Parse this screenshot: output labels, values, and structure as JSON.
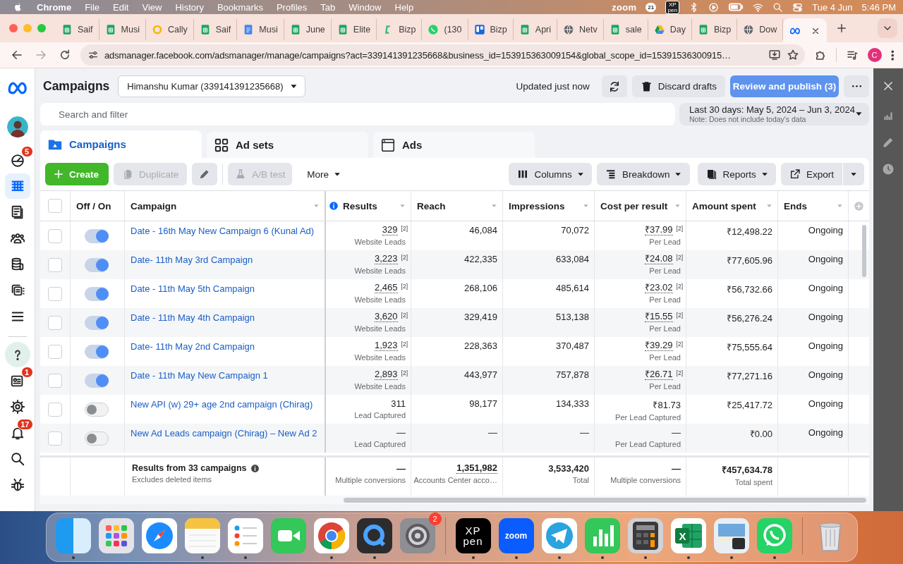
{
  "menu_bar": {
    "app": "Chrome",
    "menus": [
      "File",
      "Edit",
      "View",
      "History",
      "Bookmarks",
      "Profiles",
      "Tab",
      "Window",
      "Help"
    ],
    "status": [
      {
        "kind": "zoom",
        "label": "zoom"
      },
      {
        "kind": "count",
        "label": "21"
      },
      {
        "kind": "xppen",
        "label": "XP pen"
      },
      {
        "kind": "bluetooth"
      },
      {
        "kind": "play"
      },
      {
        "kind": "battery"
      },
      {
        "kind": "wifi"
      },
      {
        "kind": "search"
      },
      {
        "kind": "control"
      }
    ],
    "date": "Tue 4 Jun",
    "time": "5:46 PM"
  },
  "browser": {
    "tabs": [
      {
        "kind": "sheets",
        "label": "Saif",
        "selected": false
      },
      {
        "kind": "sheets",
        "label": "Musi",
        "selected": false
      },
      {
        "kind": "cally",
        "label": "Cally",
        "selected": false
      },
      {
        "kind": "sheets",
        "label": "Saif",
        "selected": false
      },
      {
        "kind": "docs",
        "label": "Musi",
        "selected": false
      },
      {
        "kind": "sheets",
        "label": "June",
        "selected": false
      },
      {
        "kind": "sheets",
        "label": "Elite",
        "selected": false
      },
      {
        "kind": "bizp",
        "label": "Bizp",
        "selected": false
      },
      {
        "kind": "whatsapp",
        "label": "(130",
        "selected": false
      },
      {
        "kind": "trello",
        "label": "Bizp",
        "selected": false
      },
      {
        "kind": "sheets",
        "label": "Apri",
        "selected": false
      },
      {
        "kind": "globe",
        "label": "Netv",
        "selected": false
      },
      {
        "kind": "sheets",
        "label": "sale",
        "selected": false
      },
      {
        "kind": "drive",
        "label": "Day",
        "selected": false
      },
      {
        "kind": "sheets",
        "label": "Bizp",
        "selected": false
      },
      {
        "kind": "globe",
        "label": "Dow",
        "selected": false
      },
      {
        "kind": "meta",
        "selected": true
      }
    ],
    "url": "adsmanager.facebook.com/adsmanager/manage/campaigns?act=339141391235668&business_id=153915363009154&global_scope_id=15391536300915…",
    "profile": "C"
  },
  "sidebar": {
    "top": [
      {
        "kind": "dashboard",
        "badge": "5",
        "selected": false
      },
      {
        "kind": "campaigns",
        "selected": true
      },
      {
        "kind": "pages",
        "selected": false
      },
      {
        "kind": "audiences",
        "selected": false
      },
      {
        "kind": "billing",
        "selected": false
      },
      {
        "kind": "ads",
        "selected": false
      },
      {
        "kind": "menu",
        "selected": false
      }
    ],
    "bottom": [
      {
        "kind": "help",
        "selected": false
      },
      {
        "kind": "news",
        "badge": "1",
        "selected": false
      },
      {
        "kind": "settings",
        "selected": false
      },
      {
        "kind": "notifications",
        "badge": "17",
        "selected": false
      },
      {
        "kind": "search",
        "selected": false
      },
      {
        "kind": "bug",
        "selected": false
      }
    ]
  },
  "header": {
    "title": "Campaigns",
    "account": "Himanshu Kumar (339141391235668)",
    "updated": "Updated just now",
    "buttons": [
      {
        "kind": "refresh"
      },
      {
        "kind": "discard",
        "label": "Discard drafts"
      },
      {
        "kind": "publish",
        "label": "Review and publish (3)",
        "disabled": true
      },
      {
        "kind": "more"
      }
    ]
  },
  "search": {
    "placeholder": "Search and filter"
  },
  "date_range": {
    "label": "Last 30 days: May 5, 2024 – Jun 3, 2024",
    "note": "Note: Does not include today's data"
  },
  "tabs": [
    {
      "kind": "campaigns",
      "label": "Campaigns",
      "selected": true
    },
    {
      "kind": "adsets",
      "label": "Ad sets",
      "selected": false
    },
    {
      "kind": "ads",
      "label": "Ads",
      "selected": false
    }
  ],
  "toolbar": {
    "left": [
      {
        "kind": "create",
        "label": "Create",
        "disabled": false
      },
      {
        "kind": "duplicate",
        "label": "Duplicate",
        "disabled": true
      },
      {
        "kind": "edit",
        "disabled": true
      },
      {
        "kind": "abtest",
        "label": "A/B test",
        "disabled": true
      },
      {
        "kind": "more",
        "label": "More",
        "disabled": false
      }
    ],
    "right": [
      {
        "kind": "columns",
        "label": "Columns"
      },
      {
        "kind": "breakdown",
        "label": "Breakdown"
      },
      {
        "kind": "reports",
        "label": "Reports"
      },
      {
        "kind": "export",
        "label": "Export"
      },
      {
        "kind": "export-menu"
      }
    ]
  },
  "table": {
    "all_checked": false,
    "columns": [
      {
        "label": "Off / On"
      },
      {
        "label": "Campaign",
        "menu": true
      },
      {
        "label": "Results",
        "menu": true,
        "info": true
      },
      {
        "label": "Reach",
        "menu": true
      },
      {
        "label": "Impressions",
        "menu": true
      },
      {
        "label": "Cost per result",
        "menu": true
      },
      {
        "label": "Amount spent",
        "menu": true
      },
      {
        "label": "Ends",
        "menu": true
      }
    ],
    "rows": [
      {
        "checked": false,
        "off_on": true,
        "campaign": "Date - 16th May New Campaign 6 (Kunal Ad)",
        "results": {
          "value": "329",
          "note": "[2]",
          "sub": "Website Leads",
          "dotted": true
        },
        "reach": "46,084",
        "impressions": "70,072",
        "cost_per_result": {
          "value": "₹37.99",
          "note": "[2]",
          "sub": "Per Lead",
          "dotted": true
        },
        "amount_spent": "₹12,498.22",
        "ends": "Ongoing"
      },
      {
        "checked": false,
        "off_on": true,
        "campaign": "Date- 11th May 3rd Campaign",
        "results": {
          "value": "3,223",
          "note": "[2]",
          "sub": "Website Leads",
          "dotted": true
        },
        "reach": "422,335",
        "impressions": "633,084",
        "cost_per_result": {
          "value": "₹24.08",
          "note": "[2]",
          "sub": "Per Lead",
          "dotted": true
        },
        "amount_spent": "₹77,605.96",
        "ends": "Ongoing"
      },
      {
        "checked": false,
        "off_on": true,
        "campaign": "Date - 11th May 5th Campaign",
        "results": {
          "value": "2,465",
          "note": "[2]",
          "sub": "Website Leads",
          "dotted": true
        },
        "reach": "268,106",
        "impressions": "485,614",
        "cost_per_result": {
          "value": "₹23.02",
          "note": "[2]",
          "sub": "Per Lead",
          "dotted": true
        },
        "amount_spent": "₹56,732.66",
        "ends": "Ongoing"
      },
      {
        "checked": false,
        "off_on": true,
        "campaign": "Date - 11th May 4th Campaign",
        "results": {
          "value": "3,620",
          "note": "[2]",
          "sub": "Website Leads",
          "dotted": true
        },
        "reach": "329,419",
        "impressions": "513,138",
        "cost_per_result": {
          "value": "₹15.55",
          "note": "[2]",
          "sub": "Per Lead",
          "dotted": true
        },
        "amount_spent": "₹56,276.24",
        "ends": "Ongoing"
      },
      {
        "checked": false,
        "off_on": true,
        "campaign": "Date- 11th May 2nd Campaign",
        "results": {
          "value": "1,923",
          "note": "[2]",
          "sub": "Website Leads",
          "dotted": true
        },
        "reach": "228,363",
        "impressions": "370,487",
        "cost_per_result": {
          "value": "₹39.29",
          "note": "[2]",
          "sub": "Per Lead",
          "dotted": true
        },
        "amount_spent": "₹75,555.64",
        "ends": "Ongoing"
      },
      {
        "checked": false,
        "off_on": true,
        "campaign": "Date - 11th May New Campaign 1",
        "results": {
          "value": "2,893",
          "note": "[2]",
          "sub": "Website Leads",
          "dotted": true
        },
        "reach": "443,977",
        "impressions": "757,878",
        "cost_per_result": {
          "value": "₹26.71",
          "note": "[2]",
          "sub": "Per Lead",
          "dotted": true
        },
        "amount_spent": "₹77,271.16",
        "ends": "Ongoing"
      },
      {
        "checked": false,
        "off_on": false,
        "campaign": "New API (w) 29+ age 2nd campaign (Chirag)",
        "results": {
          "value": "311",
          "sub": "Lead Captured"
        },
        "reach": "98,177",
        "impressions": "134,333",
        "cost_per_result": {
          "value": "₹81.73",
          "sub": "Per Lead Captured"
        },
        "amount_spent": "₹25,417.72",
        "ends": "Ongoing"
      },
      {
        "checked": false,
        "off_on": false,
        "campaign": "New Ad Leads campaign (Chirag) – New Ad 2",
        "results": {
          "value": "—",
          "sub": "Lead Captured"
        },
        "reach": "—",
        "impressions": "—",
        "cost_per_result": {
          "value": "—",
          "sub": "Per Lead Captured"
        },
        "amount_spent": "₹0.00",
        "ends": "Ongoing"
      }
    ],
    "footer": {
      "title": "Results from 33 campaigns",
      "info": true,
      "sub": "Excludes deleted items",
      "results": {
        "value": "—",
        "sub": "Multiple conversions"
      },
      "reach": {
        "value": "1,351,982",
        "sub": "Accounts Center acco…",
        "dotted": true
      },
      "impressions": {
        "value": "3,533,420",
        "sub": "Total"
      },
      "cost_per_result": {
        "value": "—",
        "sub": "Multiple conversions"
      },
      "amount_spent": {
        "value": "₹457,634.78",
        "sub": "Total spent"
      }
    }
  },
  "side_panel": {
    "buttons": [
      {
        "kind": "close"
      },
      {
        "kind": "chart"
      },
      {
        "kind": "edit"
      },
      {
        "kind": "history"
      }
    ]
  },
  "dock": {
    "groups": [
      [
        {
          "kind": "finder",
          "running": true
        },
        {
          "kind": "launchpad",
          "running": false
        },
        {
          "kind": "safari",
          "running": false
        },
        {
          "kind": "notes",
          "running": true
        },
        {
          "kind": "reminders",
          "running": true
        },
        {
          "kind": "facetime",
          "running": false
        },
        {
          "kind": "chrome",
          "running": true
        },
        {
          "kind": "quicktime",
          "running": true
        },
        {
          "kind": "settings",
          "badge": "2",
          "running": false
        }
      ],
      [
        {
          "kind": "xppen",
          "label": "XP pen",
          "running": true
        },
        {
          "kind": "zoom",
          "label": "zoom",
          "running": true
        },
        {
          "kind": "telegram",
          "running": true
        },
        {
          "kind": "numbers",
          "running": true
        },
        {
          "kind": "calculator",
          "running": true
        },
        {
          "kind": "excel",
          "label": "X",
          "running": true
        },
        {
          "kind": "preview",
          "running": true
        },
        {
          "kind": "whatsapp",
          "running": true
        }
      ],
      [
        {
          "kind": "trash",
          "running": false
        }
      ]
    ]
  }
}
